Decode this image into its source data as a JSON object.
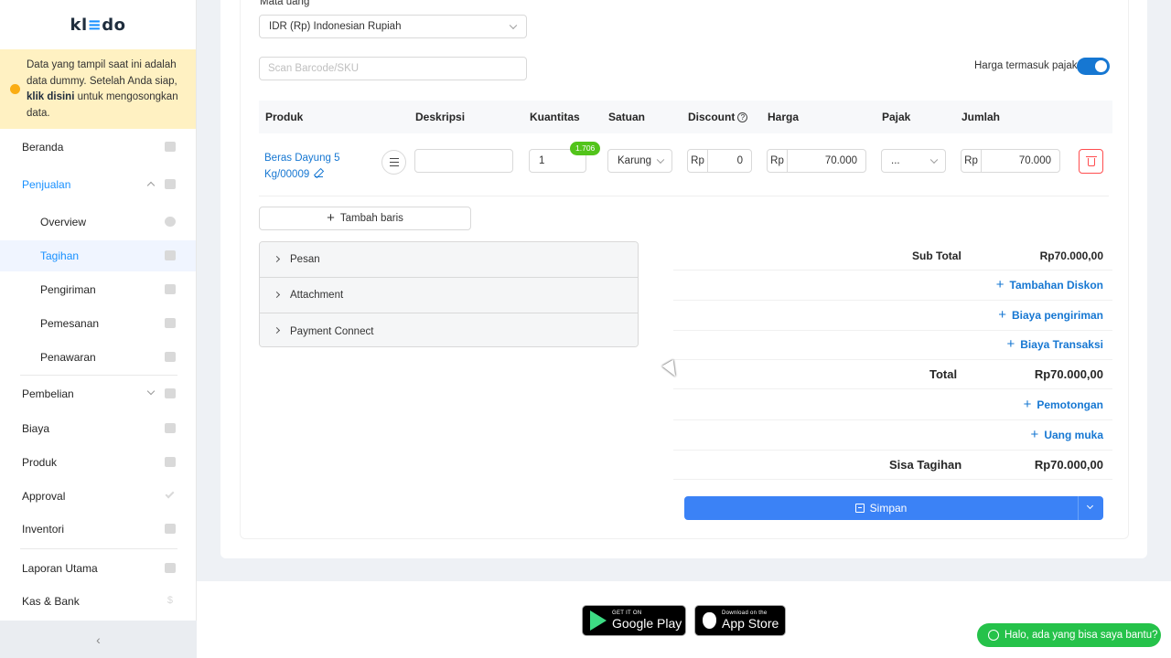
{
  "sidebar": {
    "logo_left": "kl",
    "logo_mid": "≡",
    "logo_right": "do",
    "notice_text1": "Data yang tampil saat ini adalah data dummy. Setelah Anda siap, ",
    "notice_link": "klik disini",
    "notice_text2": " untuk mengosongkan data.",
    "items": {
      "beranda": "Beranda",
      "penjualan": "Penjualan",
      "overview": "Overview",
      "tagihan": "Tagihan",
      "pengiriman": "Pengiriman",
      "pemesanan": "Pemesanan",
      "penawaran": "Penawaran",
      "pembelian": "Pembelian",
      "biaya": "Biaya",
      "produk": "Produk",
      "approval": "Approval",
      "inventori": "Inventori",
      "laporan": "Laporan Utama",
      "kas": "Kas & Bank"
    },
    "collapse_icon": "‹"
  },
  "form": {
    "currency_label": "Mata uang",
    "currency_value": "IDR (Rp) Indonesian Rupiah",
    "barcode_placeholder": "Scan Barcode/SKU",
    "tax_inclusive_label": "Harga termasuk pajak",
    "tax_inclusive_on": true
  },
  "table": {
    "headers": {
      "produk": "Produk",
      "deskripsi": "Deskripsi",
      "kuantitas": "Kuantitas",
      "satuan": "Satuan",
      "discount": "Discount",
      "harga": "Harga",
      "pajak": "Pajak",
      "jumlah": "Jumlah"
    },
    "row": {
      "product": "Beras Dayung 5 Kg/00009",
      "description": "",
      "quantity": "1",
      "stock_badge": "1.706",
      "unit": "Karung",
      "discount_prefix": "Rp",
      "discount": "0",
      "price_prefix": "Rp",
      "price": "70.000",
      "tax": "...",
      "amount_prefix": "Rp",
      "amount": "70.000"
    },
    "add_row_label": "Tambah baris"
  },
  "sections": {
    "pesan": "Pesan",
    "attachment": "Attachment",
    "payment_connect": "Payment Connect"
  },
  "summary": {
    "subtotal_label": "Sub Total",
    "subtotal_value": "Rp70.000,00",
    "tambahan_diskon": "Tambahan Diskon",
    "biaya_pengiriman": "Biaya pengiriman",
    "biaya_transaksi": "Biaya Transaksi",
    "total_label": "Total",
    "total_value": "Rp70.000,00",
    "pemotongan": "Pemotongan",
    "uang_muka": "Uang muka",
    "sisa_label": "Sisa Tagihan",
    "sisa_value": "Rp70.000,00",
    "save_label": "Simpan"
  },
  "footer": {
    "google_small": "GET IT ON",
    "google_big": "Google Play",
    "apple_small": "Download on the",
    "apple_big": "App Store",
    "chat_label": "Halo, ada yang bisa saya bantu?"
  },
  "colors": {
    "primary": "#1677d2",
    "save_button": "#3b82f6",
    "notice_bg": "#fff1c2",
    "delete": "#ff4d4f",
    "badge": "#52c41a",
    "whatsapp": "#25c24a"
  }
}
